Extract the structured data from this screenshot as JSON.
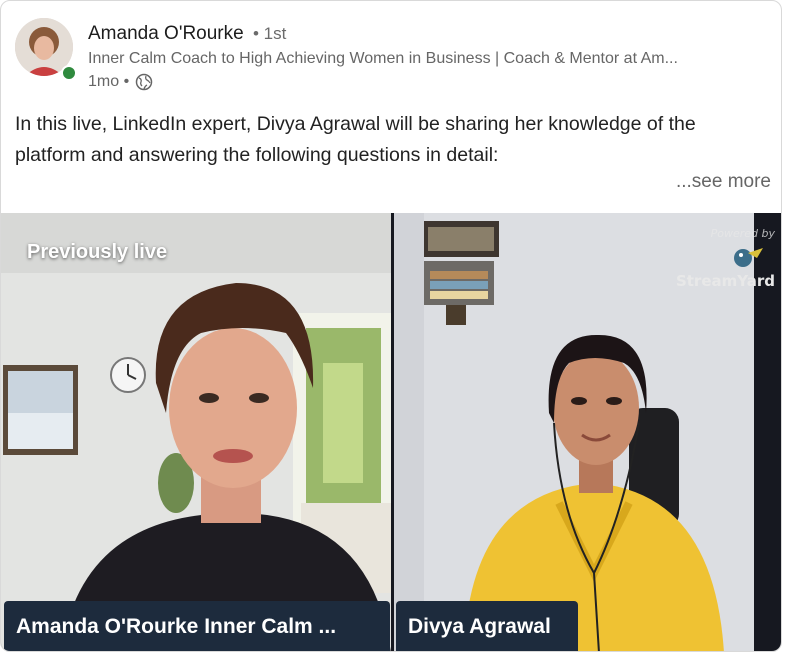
{
  "post": {
    "author_name": "Amanda O'Rourke",
    "degree": "• 1st",
    "headline": "Inner Calm Coach to High Achieving Women in Business | Coach & Mentor at Am...",
    "time": "1mo •",
    "text": "In this live, LinkedIn expert, Divya Agrawal will be sharing her knowledge of the platform and answering the following questions in detail:",
    "see_more": "...see more"
  },
  "video": {
    "status": "Previously live",
    "powered_by": "Powered by",
    "brand": "StreamYard",
    "participants": [
      {
        "name": "Amanda O'Rourke Inner Calm ..."
      },
      {
        "name": "Divya Agrawal"
      }
    ]
  },
  "colors": {
    "name_tag_bg": "#1d2b3d",
    "presence_online": "#2f8a3e",
    "muted_text": "#666666"
  }
}
